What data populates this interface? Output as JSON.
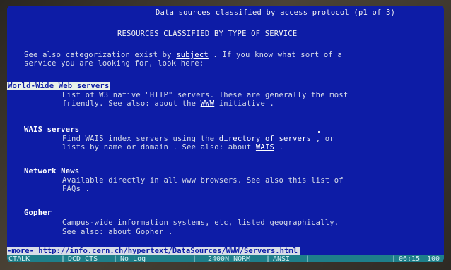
{
  "header": {
    "title": "Data sources classified by access protocol (p1 of 3)",
    "heading": "RESOURCES CLASSIFIED BY TYPE OF SERVICE"
  },
  "intro": {
    "line1_a": "See also categorization exist by ",
    "line1_link": "subject",
    "line1_b": " . If you know what sort of a",
    "line2": "service you are looking for, look here:"
  },
  "sections": {
    "www": {
      "title": "World-Wide Web servers",
      "line1": "List of W3 native \"HTTP\" servers. These are generally the most",
      "line2_a": "friendly. See also: about the ",
      "line2_link": "WWW",
      "line2_b": " initiative ."
    },
    "wais": {
      "title": "WAIS servers",
      "line1_a": "Find WAIS index servers using the ",
      "line1_link": "directory of servers",
      "line1_b": " , or",
      "line2_a": "lists by name or domain . See also: about ",
      "line2_link": "WAIS",
      "line2_b": " ."
    },
    "news": {
      "title": "Network News",
      "line1": "Available directly in all www browsers. See also this list of",
      "line2": "FAQs ."
    },
    "gopher": {
      "title": "Gopher",
      "line1": "Campus-wide information systems, etc, listed geographically.",
      "line2": "See also: about Gopher ."
    }
  },
  "footer": {
    "more": "-more-",
    "url": " http://info.cern.ch/hypertext/DataSources/WWW/Servers.html"
  },
  "status_bar": {
    "cells": [
      "CTALK",
      "DCD CTS",
      "No Log",
      "2400N NORM",
      "ANSI",
      "06:15",
      "100"
    ]
  }
}
